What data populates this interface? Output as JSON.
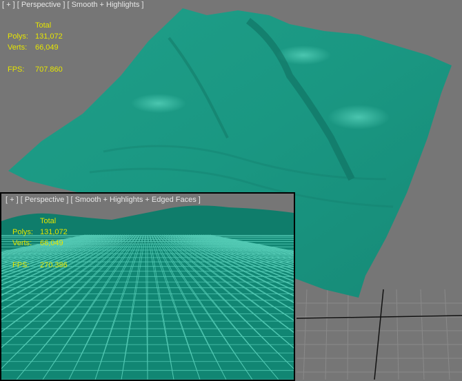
{
  "main_viewport": {
    "label_plus": "[ + ]",
    "label_view": "[ Perspective ]",
    "label_shading": "[ Smooth + Highlights ]",
    "stats": {
      "header": "Total",
      "polys_label": "Polys:",
      "polys_value": "131,072",
      "verts_label": "Verts:",
      "verts_value": "66,049",
      "fps_label": "FPS:",
      "fps_value": "707.860"
    }
  },
  "inset_viewport": {
    "label_plus": "[ + ]",
    "label_view": "[ Perspective ]",
    "label_shading": "[ Smooth + Highlights + Edged Faces ]",
    "stats": {
      "header": "Total",
      "polys_label": "Polys:",
      "polys_value": "131,072",
      "verts_label": "Verts:",
      "verts_value": "66,049",
      "fps_label": "FPS:",
      "fps_value": "270.386"
    }
  },
  "colors": {
    "viewport_bg": "#767676",
    "terrain": "#1a9a84",
    "terrain_light": "#3cc7ae",
    "stats_text": "#e6e600",
    "label_text": "#e6e6e6"
  }
}
